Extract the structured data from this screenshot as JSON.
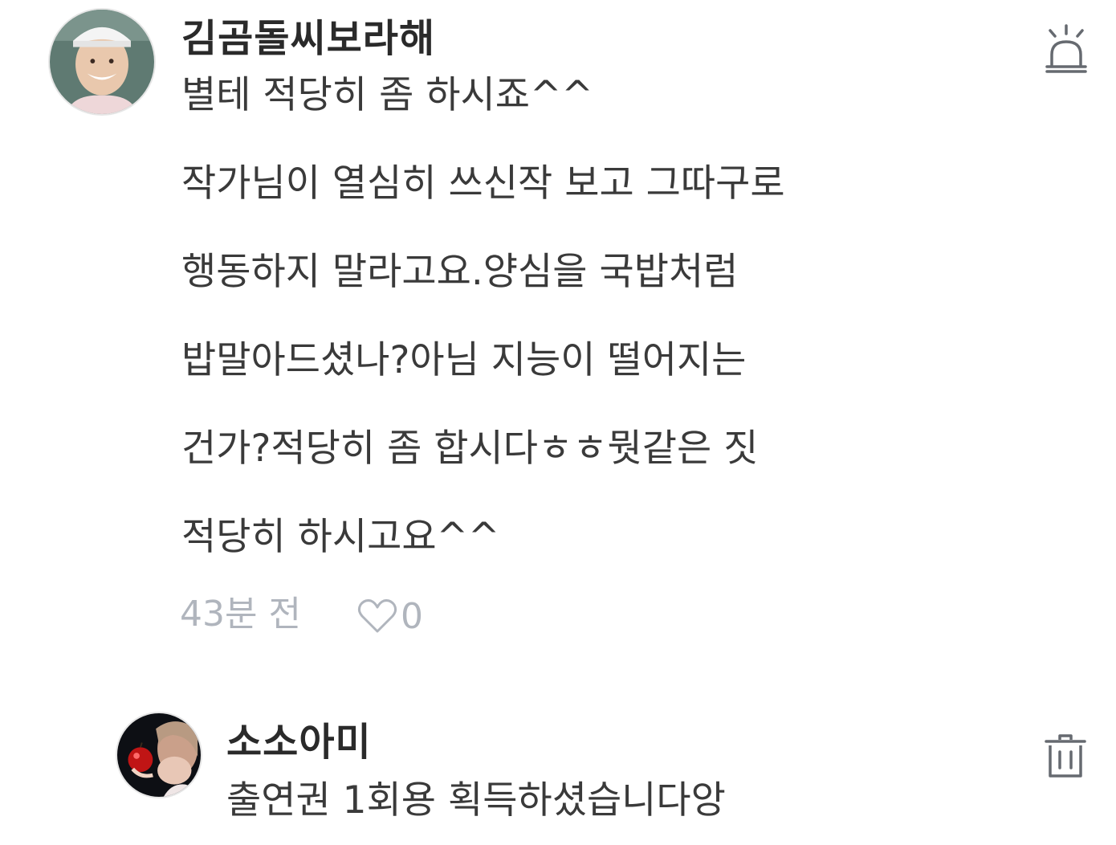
{
  "comments": [
    {
      "username": "김곰돌씨보라해",
      "lines": [
        "별테 적당히 좀 하시죠^^",
        "작가님이 열심히 쓰신작 보고 그따구로",
        "행동하지 말라고요.양심을 국밥처럼",
        "밥말아드셨나?아님 지능이 떨어지는",
        "건가?적당히 좀 합시다ㅎㅎ뭣같은 짓",
        "적당히 하시고요^^"
      ],
      "time": "43분 전",
      "likes": "0",
      "action_icon": "siren-report-icon"
    },
    {
      "username": "소소아미",
      "lines": [
        "출연권 1회용 획득하셨습니다앙"
      ],
      "action_icon": "trash-icon"
    }
  ],
  "colors": {
    "text": "#3a3a3a",
    "username": "#2a2a2a",
    "meta": "#b0b5bd",
    "icon": "#666a70"
  }
}
